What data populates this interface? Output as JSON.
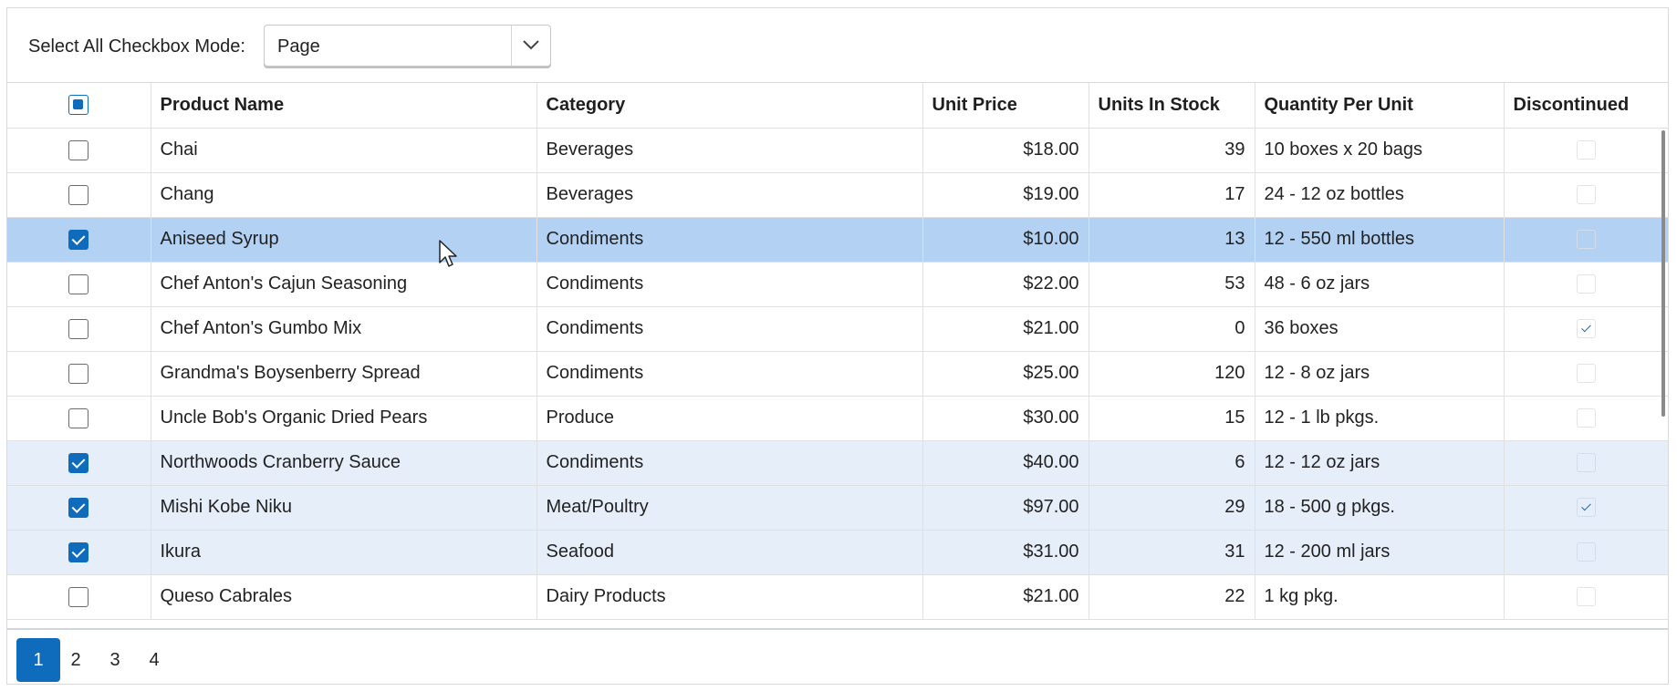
{
  "toolbar": {
    "label": "Select All Checkbox Mode:",
    "select_value": "Page",
    "arrow_icon": "chevron-down-icon"
  },
  "columns": [
    "",
    "Product Name",
    "Category",
    "Unit Price",
    "Units In Stock",
    "Quantity Per Unit",
    "Discontinued"
  ],
  "header_checkbox_state": "indeterminate",
  "rows": [
    {
      "selected": false,
      "name": "Chai",
      "category": "Beverages",
      "price": "$18.00",
      "stock": "39",
      "qty": "10 boxes x 20 bags",
      "discontinued": false
    },
    {
      "selected": false,
      "name": "Chang",
      "category": "Beverages",
      "price": "$19.00",
      "stock": "17",
      "qty": "24 - 12 oz bottles",
      "discontinued": false
    },
    {
      "selected": true,
      "name": "Aniseed Syrup",
      "category": "Condiments",
      "price": "$10.00",
      "stock": "13",
      "qty": "12 - 550 ml bottles",
      "discontinued": false,
      "focused": true
    },
    {
      "selected": false,
      "name": "Chef Anton's Cajun Seasoning",
      "category": "Condiments",
      "price": "$22.00",
      "stock": "53",
      "qty": "48 - 6 oz jars",
      "discontinued": false
    },
    {
      "selected": false,
      "name": "Chef Anton's Gumbo Mix",
      "category": "Condiments",
      "price": "$21.00",
      "stock": "0",
      "qty": "36 boxes",
      "discontinued": true
    },
    {
      "selected": false,
      "name": "Grandma's Boysenberry Spread",
      "category": "Condiments",
      "price": "$25.00",
      "stock": "120",
      "qty": "12 - 8 oz jars",
      "discontinued": false
    },
    {
      "selected": false,
      "name": "Uncle Bob's Organic Dried Pears",
      "category": "Produce",
      "price": "$30.00",
      "stock": "15",
      "qty": "12 - 1 lb pkgs.",
      "discontinued": false
    },
    {
      "selected": true,
      "name": "Northwoods Cranberry Sauce",
      "category": "Condiments",
      "price": "$40.00",
      "stock": "6",
      "qty": "12 - 12 oz jars",
      "discontinued": false
    },
    {
      "selected": true,
      "name": "Mishi Kobe Niku",
      "category": "Meat/Poultry",
      "price": "$97.00",
      "stock": "29",
      "qty": "18 - 500 g pkgs.",
      "discontinued": true
    },
    {
      "selected": true,
      "name": "Ikura",
      "category": "Seafood",
      "price": "$31.00",
      "stock": "31",
      "qty": "12 - 200 ml jars",
      "discontinued": false
    },
    {
      "selected": false,
      "name": "Queso Cabrales",
      "category": "Dairy Products",
      "price": "$21.00",
      "stock": "22",
      "qty": "1 kg pkg.",
      "discontinued": false
    }
  ],
  "pager": {
    "pages": [
      "1",
      "2",
      "3",
      "4"
    ],
    "current": "1"
  },
  "colors": {
    "accent": "#0f6cbd",
    "row_focused": "#b3d1f3",
    "row_selected": "#e6eefa"
  }
}
